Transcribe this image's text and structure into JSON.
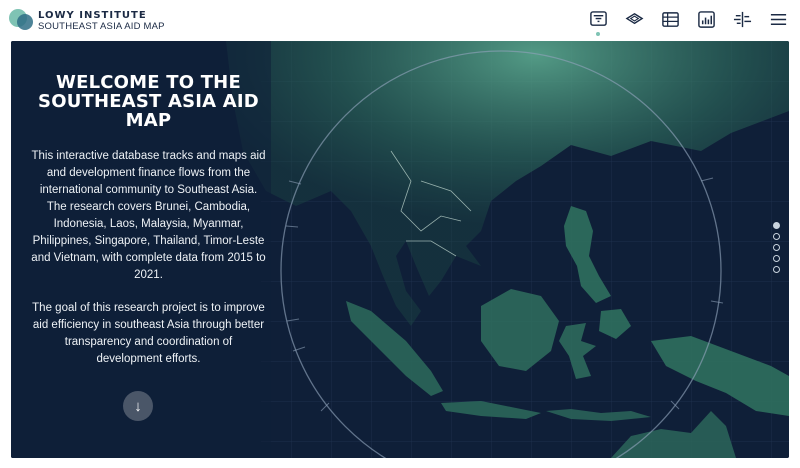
{
  "header": {
    "org_name": "LOWY INSTITUTE",
    "project_name": "SOUTHEAST ASIA AID MAP"
  },
  "nav": {
    "items": [
      {
        "name": "filter-icon",
        "active": true
      },
      {
        "name": "map-layers-icon",
        "active": false
      },
      {
        "name": "table-icon",
        "active": false
      },
      {
        "name": "bar-chart-icon",
        "active": false
      },
      {
        "name": "compare-icon",
        "active": false
      },
      {
        "name": "menu-icon",
        "active": false
      }
    ]
  },
  "hero": {
    "title": "WELCOME TO THE SOUTHEAST ASIA AID MAP",
    "paragraph_1": "This interactive database tracks and maps aid and development finance flows from the international community to Southeast Asia. The research covers Brunei, Cambodia, Indonesia, Laos, Malaysia, Myanmar, Philippines, Singapore, Thailand, Timor-Leste and Vietnam, with complete data from 2015 to 2021.",
    "paragraph_2": "The goal of this research project is to improve aid efficiency in southeast Asia through better transparency and coordination of development efforts.",
    "scroll_icon": "arrow-down-icon",
    "scroll_glyph": "↓"
  },
  "pager": {
    "count": 5,
    "active_index": 0
  },
  "colors": {
    "background": "#0f1f38",
    "land": "#2f6f5e",
    "land_highlight": "#4f9a80",
    "accent": "#7fc3b4",
    "text": "#ffffff"
  }
}
